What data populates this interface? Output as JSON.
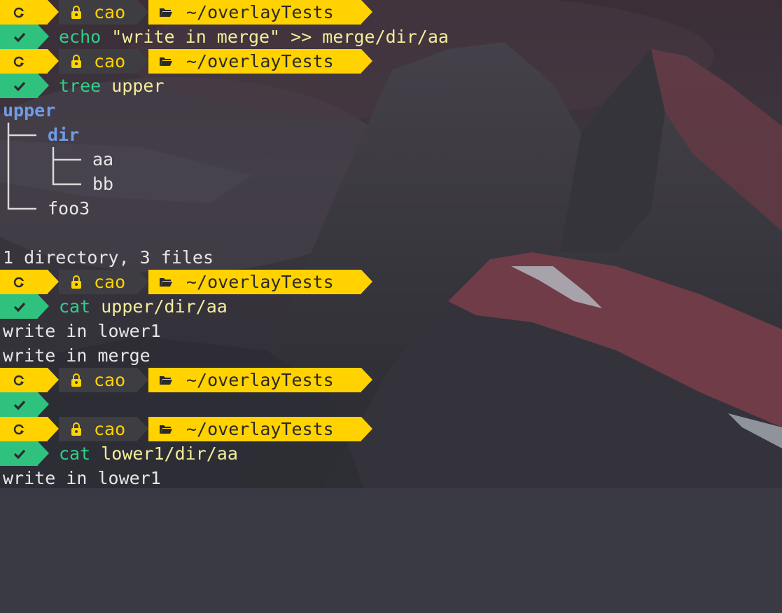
{
  "prompt": {
    "user": "cao",
    "cwd": "~/overlayTests",
    "colors": {
      "yellow": "#ffd200",
      "dark": "#3e3e42",
      "green": "#2ec27e",
      "text_dark": "#2a2a2a",
      "user_text": "#ffd200"
    },
    "icons": {
      "os": "tux-debian-icon",
      "user": "lock-user-icon",
      "folder": "folder-open-icon",
      "status": "check-icon"
    }
  },
  "session": [
    {
      "command": "echo",
      "args": "\"write in merge\" >> merge/dir/aa"
    },
    {
      "command": "tree",
      "args": "upper"
    },
    {
      "command": "cat",
      "args": "upper/dir/aa"
    },
    {
      "command": "",
      "args": ""
    },
    {
      "command": "cat",
      "args": "lower1/dir/aa"
    }
  ],
  "tree_output": {
    "root": "upper",
    "dir": "dir",
    "file_aa": "aa",
    "file_bb": "bb",
    "file_foo3": "foo3",
    "summary": "1 directory, 3 files"
  },
  "cat_upper_output": [
    "write in lower1",
    "write in merge"
  ],
  "cat_lower_output": [
    "write in lower1"
  ]
}
